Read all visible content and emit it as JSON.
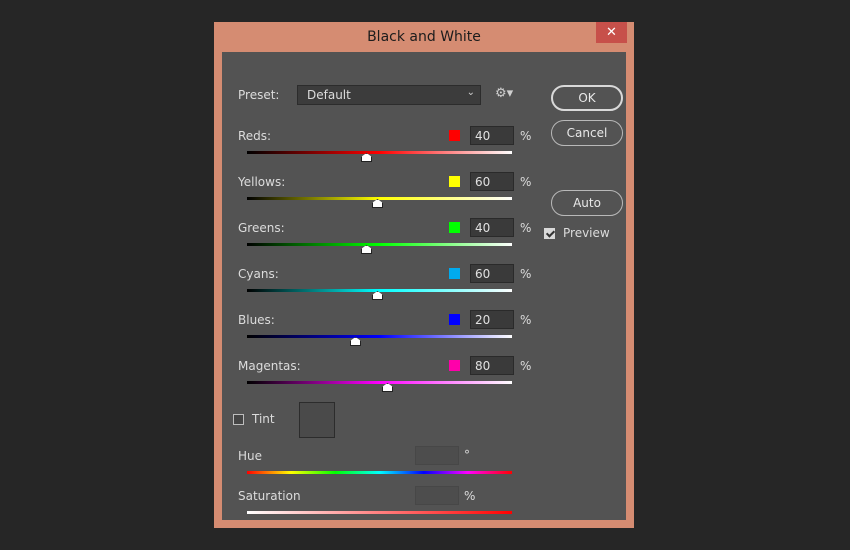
{
  "window": {
    "title": "Black and White",
    "close_glyph": "✕"
  },
  "preset": {
    "label": "Preset:",
    "value": "Default",
    "chevron": "⌄",
    "gear": "⚙▾"
  },
  "buttons": {
    "ok": "OK",
    "cancel": "Cancel",
    "auto": "Auto"
  },
  "preview": {
    "label": "Preview",
    "checked": true
  },
  "unit_percent": "%",
  "sliders": [
    {
      "label": "Reds:",
      "value": "40",
      "swatch": "#ff0000",
      "start": "#000000",
      "mid": "#ff0000"
    },
    {
      "label": "Yellows:",
      "value": "60",
      "swatch": "#ffff00",
      "start": "#000000",
      "mid": "#ffff00"
    },
    {
      "label": "Greens:",
      "value": "40",
      "swatch": "#00ff00",
      "start": "#000000",
      "mid": "#00ff00"
    },
    {
      "label": "Cyans:",
      "value": "60",
      "swatch": "#00aaee",
      "start": "#000000",
      "mid": "#00ffff"
    },
    {
      "label": "Blues:",
      "value": "20",
      "swatch": "#0000ff",
      "start": "#000000",
      "mid": "#0000ff"
    },
    {
      "label": "Magentas:",
      "value": "80",
      "swatch": "#ff00aa",
      "start": "#000000",
      "mid": "#ff00ff"
    }
  ],
  "tint": {
    "label": "Tint",
    "checked": false
  },
  "hue": {
    "label": "Hue",
    "value": "",
    "unit": "°"
  },
  "saturation": {
    "label": "Saturation",
    "value": "",
    "unit": "%"
  }
}
